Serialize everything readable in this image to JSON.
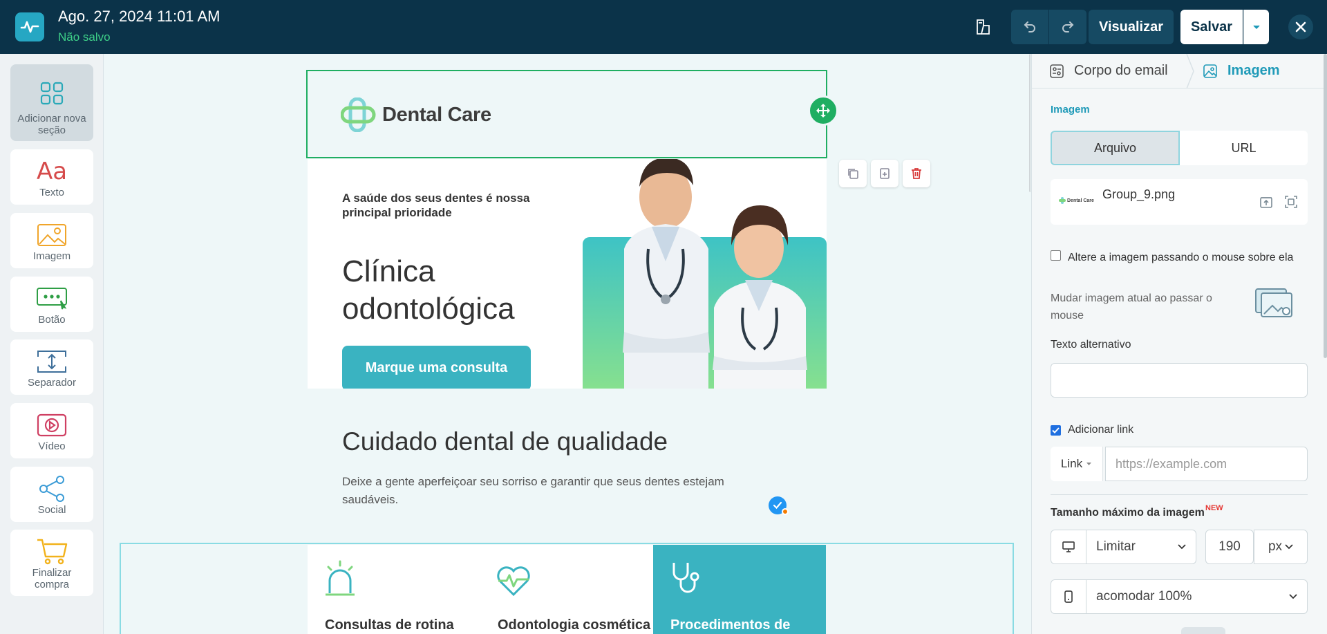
{
  "topbar": {
    "title": "Ago. 27, 2024 11:01 AM",
    "status": "Não salvo",
    "preview_label": "Visualizar",
    "save_label": "Salvar"
  },
  "sidebar": {
    "items": [
      {
        "label": "Adicionar nova seção",
        "icon": "grid-icon"
      },
      {
        "label": "Texto",
        "icon": "text-aa-icon"
      },
      {
        "label": "Imagem",
        "icon": "image-icon"
      },
      {
        "label": "Botão",
        "icon": "button-icon"
      },
      {
        "label": "Separador",
        "icon": "separator-icon"
      },
      {
        "label": "Vídeo",
        "icon": "video-icon"
      },
      {
        "label": "Social",
        "icon": "share-icon"
      },
      {
        "label": "Finalizar compra",
        "icon": "cart-icon"
      }
    ]
  },
  "canvas": {
    "brand": "Dental Care",
    "hero": {
      "tagline": "A saúde dos seus dentes é nossa principal prioridade",
      "title": "Clínica odontológica",
      "cta": "Marque uma consulta"
    },
    "section": {
      "title": "Cuidado dental de qualidade",
      "text": "Deixe a gente aperfeiçoar seu sorriso e garantir que seus dentes estejam saudáveis."
    },
    "services": [
      {
        "label": "Consultas de rotina",
        "icon": "bell-alert-icon"
      },
      {
        "label": "Odontologia cosmética",
        "icon": "heart-pulse-icon"
      },
      {
        "label": "Procedimentos de",
        "icon": "stethoscope-icon"
      }
    ]
  },
  "panel": {
    "tab_body": "Corpo do email",
    "tab_image": "Imagem",
    "section_label": "Imagem",
    "seg_file": "Arquivo",
    "seg_url": "URL",
    "file_name": "Group_9.png",
    "file_thumb_text": "Dental Care",
    "hover_label": "Altere a imagem passando o mouse sobre ela",
    "hover_desc": "Mudar imagem atual ao passar o mouse",
    "alt_label": "Texto alternativo",
    "alt_value": "",
    "add_link_label": "Adicionar link",
    "link_type": "Link",
    "link_placeholder": "https://example.com",
    "max_size_label": "Tamanho máximo da imagem",
    "new_badge": "NEW",
    "desktop_mode": "Limitar",
    "desktop_value": "190",
    "desktop_unit": "px",
    "mobile_mode": "acomodar 100%"
  },
  "colors": {
    "topbar": "#0b3349",
    "accent": "#3ab3c1",
    "selection": "#1fae62",
    "saved_status": "#3ed088"
  }
}
